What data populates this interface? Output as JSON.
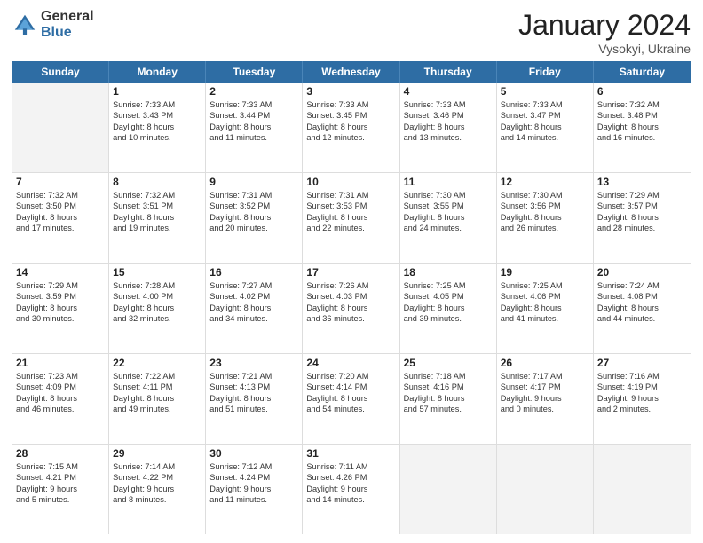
{
  "header": {
    "logo_general": "General",
    "logo_blue": "Blue",
    "month_title": "January 2024",
    "location": "Vysokyi, Ukraine"
  },
  "weekdays": [
    "Sunday",
    "Monday",
    "Tuesday",
    "Wednesday",
    "Thursday",
    "Friday",
    "Saturday"
  ],
  "rows": [
    [
      {
        "day": "",
        "lines": [],
        "shaded": true
      },
      {
        "day": "1",
        "lines": [
          "Sunrise: 7:33 AM",
          "Sunset: 3:43 PM",
          "Daylight: 8 hours",
          "and 10 minutes."
        ]
      },
      {
        "day": "2",
        "lines": [
          "Sunrise: 7:33 AM",
          "Sunset: 3:44 PM",
          "Daylight: 8 hours",
          "and 11 minutes."
        ]
      },
      {
        "day": "3",
        "lines": [
          "Sunrise: 7:33 AM",
          "Sunset: 3:45 PM",
          "Daylight: 8 hours",
          "and 12 minutes."
        ]
      },
      {
        "day": "4",
        "lines": [
          "Sunrise: 7:33 AM",
          "Sunset: 3:46 PM",
          "Daylight: 8 hours",
          "and 13 minutes."
        ]
      },
      {
        "day": "5",
        "lines": [
          "Sunrise: 7:33 AM",
          "Sunset: 3:47 PM",
          "Daylight: 8 hours",
          "and 14 minutes."
        ]
      },
      {
        "day": "6",
        "lines": [
          "Sunrise: 7:32 AM",
          "Sunset: 3:48 PM",
          "Daylight: 8 hours",
          "and 16 minutes."
        ]
      }
    ],
    [
      {
        "day": "7",
        "lines": [
          "Sunrise: 7:32 AM",
          "Sunset: 3:50 PM",
          "Daylight: 8 hours",
          "and 17 minutes."
        ]
      },
      {
        "day": "8",
        "lines": [
          "Sunrise: 7:32 AM",
          "Sunset: 3:51 PM",
          "Daylight: 8 hours",
          "and 19 minutes."
        ]
      },
      {
        "day": "9",
        "lines": [
          "Sunrise: 7:31 AM",
          "Sunset: 3:52 PM",
          "Daylight: 8 hours",
          "and 20 minutes."
        ]
      },
      {
        "day": "10",
        "lines": [
          "Sunrise: 7:31 AM",
          "Sunset: 3:53 PM",
          "Daylight: 8 hours",
          "and 22 minutes."
        ]
      },
      {
        "day": "11",
        "lines": [
          "Sunrise: 7:30 AM",
          "Sunset: 3:55 PM",
          "Daylight: 8 hours",
          "and 24 minutes."
        ]
      },
      {
        "day": "12",
        "lines": [
          "Sunrise: 7:30 AM",
          "Sunset: 3:56 PM",
          "Daylight: 8 hours",
          "and 26 minutes."
        ]
      },
      {
        "day": "13",
        "lines": [
          "Sunrise: 7:29 AM",
          "Sunset: 3:57 PM",
          "Daylight: 8 hours",
          "and 28 minutes."
        ]
      }
    ],
    [
      {
        "day": "14",
        "lines": [
          "Sunrise: 7:29 AM",
          "Sunset: 3:59 PM",
          "Daylight: 8 hours",
          "and 30 minutes."
        ]
      },
      {
        "day": "15",
        "lines": [
          "Sunrise: 7:28 AM",
          "Sunset: 4:00 PM",
          "Daylight: 8 hours",
          "and 32 minutes."
        ]
      },
      {
        "day": "16",
        "lines": [
          "Sunrise: 7:27 AM",
          "Sunset: 4:02 PM",
          "Daylight: 8 hours",
          "and 34 minutes."
        ]
      },
      {
        "day": "17",
        "lines": [
          "Sunrise: 7:26 AM",
          "Sunset: 4:03 PM",
          "Daylight: 8 hours",
          "and 36 minutes."
        ]
      },
      {
        "day": "18",
        "lines": [
          "Sunrise: 7:25 AM",
          "Sunset: 4:05 PM",
          "Daylight: 8 hours",
          "and 39 minutes."
        ]
      },
      {
        "day": "19",
        "lines": [
          "Sunrise: 7:25 AM",
          "Sunset: 4:06 PM",
          "Daylight: 8 hours",
          "and 41 minutes."
        ]
      },
      {
        "day": "20",
        "lines": [
          "Sunrise: 7:24 AM",
          "Sunset: 4:08 PM",
          "Daylight: 8 hours",
          "and 44 minutes."
        ]
      }
    ],
    [
      {
        "day": "21",
        "lines": [
          "Sunrise: 7:23 AM",
          "Sunset: 4:09 PM",
          "Daylight: 8 hours",
          "and 46 minutes."
        ]
      },
      {
        "day": "22",
        "lines": [
          "Sunrise: 7:22 AM",
          "Sunset: 4:11 PM",
          "Daylight: 8 hours",
          "and 49 minutes."
        ]
      },
      {
        "day": "23",
        "lines": [
          "Sunrise: 7:21 AM",
          "Sunset: 4:13 PM",
          "Daylight: 8 hours",
          "and 51 minutes."
        ]
      },
      {
        "day": "24",
        "lines": [
          "Sunrise: 7:20 AM",
          "Sunset: 4:14 PM",
          "Daylight: 8 hours",
          "and 54 minutes."
        ]
      },
      {
        "day": "25",
        "lines": [
          "Sunrise: 7:18 AM",
          "Sunset: 4:16 PM",
          "Daylight: 8 hours",
          "and 57 minutes."
        ]
      },
      {
        "day": "26",
        "lines": [
          "Sunrise: 7:17 AM",
          "Sunset: 4:17 PM",
          "Daylight: 9 hours",
          "and 0 minutes."
        ]
      },
      {
        "day": "27",
        "lines": [
          "Sunrise: 7:16 AM",
          "Sunset: 4:19 PM",
          "Daylight: 9 hours",
          "and 2 minutes."
        ]
      }
    ],
    [
      {
        "day": "28",
        "lines": [
          "Sunrise: 7:15 AM",
          "Sunset: 4:21 PM",
          "Daylight: 9 hours",
          "and 5 minutes."
        ]
      },
      {
        "day": "29",
        "lines": [
          "Sunrise: 7:14 AM",
          "Sunset: 4:22 PM",
          "Daylight: 9 hours",
          "and 8 minutes."
        ]
      },
      {
        "day": "30",
        "lines": [
          "Sunrise: 7:12 AM",
          "Sunset: 4:24 PM",
          "Daylight: 9 hours",
          "and 11 minutes."
        ]
      },
      {
        "day": "31",
        "lines": [
          "Sunrise: 7:11 AM",
          "Sunset: 4:26 PM",
          "Daylight: 9 hours",
          "and 14 minutes."
        ]
      },
      {
        "day": "",
        "lines": [],
        "shaded": true
      },
      {
        "day": "",
        "lines": [],
        "shaded": true
      },
      {
        "day": "",
        "lines": [],
        "shaded": true
      }
    ]
  ]
}
